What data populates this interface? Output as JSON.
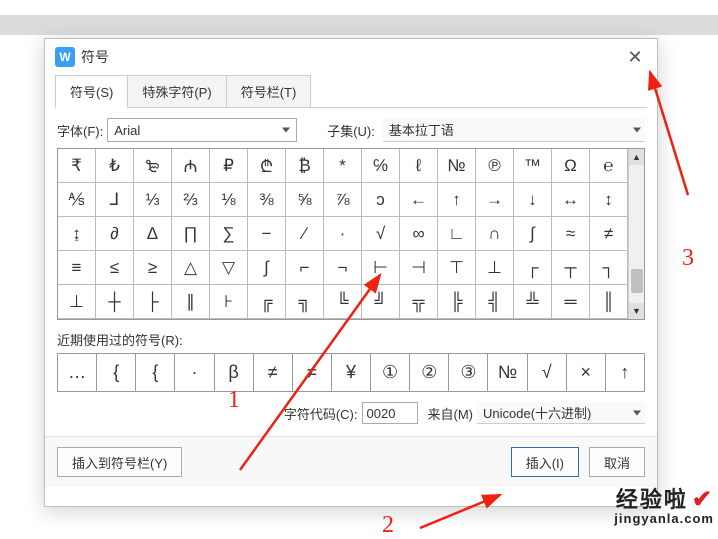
{
  "window": {
    "title": "符号",
    "icon_letter": "W"
  },
  "tabs": {
    "0": {
      "label": "符号(S)"
    },
    "1": {
      "label": "特殊字符(P)"
    },
    "2": {
      "label": "符号栏(T)"
    }
  },
  "font": {
    "label": "字体(F):",
    "value": "Arial"
  },
  "subset": {
    "label": "子集(U):",
    "value": "基本拉丁语"
  },
  "grid_rows": [
    [
      "₹",
      "₺",
      "₻",
      "₼",
      "₽",
      "₾",
      "₿",
      "*",
      "℅",
      "ℓ",
      "№",
      "℗",
      "™",
      "Ω",
      "℮"
    ],
    [
      "⅍",
      "⅃",
      "⅓",
      "⅔",
      "⅛",
      "⅜",
      "⅝",
      "⅞",
      "ↄ",
      "←",
      "↑",
      "→",
      "↓",
      "↔",
      "↕"
    ],
    [
      "↨",
      "∂",
      "∆",
      "∏",
      "∑",
      "−",
      "∕",
      "∙",
      "√",
      "∞",
      "∟",
      "∩",
      "∫",
      "≈",
      "≠"
    ],
    [
      "≡",
      "≤",
      "≥",
      "△",
      "▽",
      "∫",
      "⌐",
      "¬",
      "⊢",
      "⊣",
      "⊤",
      "⊥",
      "┌",
      "┬",
      "┐"
    ],
    [
      "⊥",
      "┼",
      "├",
      "∥",
      "⊦",
      "╔",
      "╗",
      "╚",
      "╝",
      "╦",
      "╠",
      "╣",
      "╩",
      "═",
      "║"
    ]
  ],
  "recent": {
    "label": "近期使用过的符号(R):",
    "items": [
      "…",
      "{",
      "{",
      "·",
      "β",
      "≠",
      "≠",
      "¥",
      "①",
      "②",
      "③",
      "№",
      "√",
      "×",
      "↑"
    ]
  },
  "charcode": {
    "label": "字符代码(C):",
    "value": "0020",
    "from_label": "来自(M)",
    "encoding": "Unicode(十六进制)"
  },
  "buttons": {
    "insert_to_bar": "插入到符号栏(Y)",
    "insert": "插入(I)",
    "cancel": "取消"
  },
  "annotations": {
    "n1": "1",
    "n2": "2",
    "n3": "3"
  },
  "watermark": {
    "line1": "经验啦",
    "line2": "jingyanla.com"
  }
}
